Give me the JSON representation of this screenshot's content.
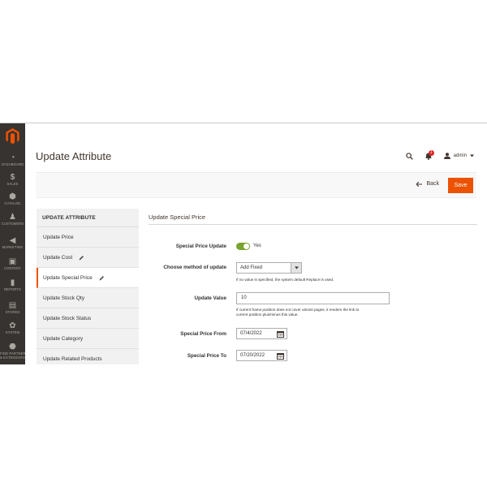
{
  "sidebar": {
    "items": [
      {
        "label": "DASHBOARD",
        "icon": "dashboard-icon"
      },
      {
        "label": "SALES",
        "icon": "dollar-icon"
      },
      {
        "label": "CATALOG",
        "icon": "cube-icon"
      },
      {
        "label": "CUSTOMERS",
        "icon": "person-icon"
      },
      {
        "label": "MARKETING",
        "icon": "megaphone-icon"
      },
      {
        "label": "CONTENT",
        "icon": "layout-icon"
      },
      {
        "label": "REPORTS",
        "icon": "bar-chart-icon"
      },
      {
        "label": "STORES",
        "icon": "store-icon"
      },
      {
        "label": "SYSTEM",
        "icon": "gear-icon"
      },
      {
        "label": "FIND PARTNERS",
        "label2": "& EXTENSIONS",
        "icon": "partners-icon"
      }
    ]
  },
  "header": {
    "title": "Update Attribute",
    "notifications_count": "1",
    "user": "admin"
  },
  "actions": {
    "back": "Back",
    "save": "Save"
  },
  "tabs": {
    "title": "UPDATE ATTRIBUTE",
    "items": [
      "Update Price",
      "Update Cost",
      "Update Special Price",
      "Update Stock Qty",
      "Update Stock Status",
      "Update Category",
      "Update Related Products"
    ]
  },
  "form": {
    "section_title": "Update Special Price",
    "special_price_update": {
      "label": "Special Price Update",
      "value": "Yes"
    },
    "method": {
      "label": "Choose method of update",
      "value": "Add Fixed",
      "note": "If no value is specified, the system default Replace is used."
    },
    "update_value": {
      "label": "Update Value",
      "value": "10",
      "note_line1": "If current frame position does not cover utmost pages, it renders the link to",
      "note_line2": "current position plus/minus this value."
    },
    "special_price_from": {
      "label": "Special Price From",
      "value": "07/4/2022"
    },
    "special_price_to": {
      "label": "Special Price To",
      "value": "07/20/2022"
    }
  },
  "colors": {
    "sidebar_bg": "#373330",
    "accent": "#eb5202",
    "toggle_on": "#79a22e"
  }
}
